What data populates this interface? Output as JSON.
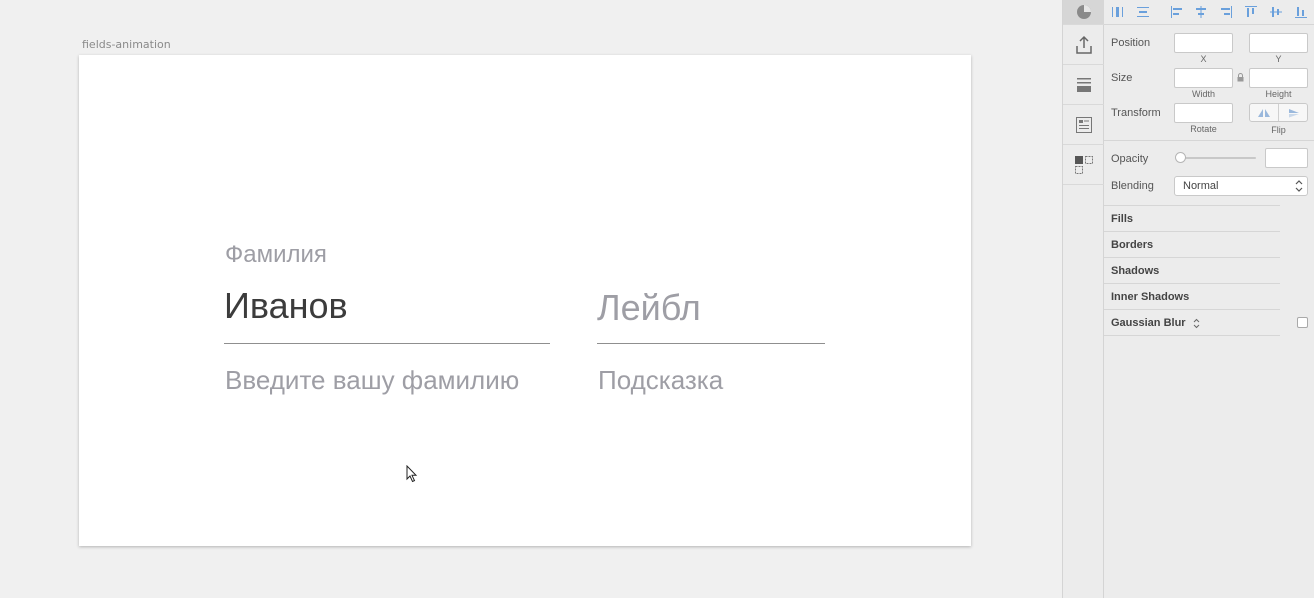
{
  "canvas": {
    "artboard_name": "fields-animation",
    "fields": {
      "lastname": {
        "label": "Фамилия",
        "value": "Иванов",
        "hint": "Введите вашу фамилию"
      },
      "generic": {
        "placeholder": "Лейбл",
        "hint": "Подсказка"
      }
    }
  },
  "toolstrip": {
    "icons": [
      "style-icon",
      "export-icon",
      "layers-icon",
      "list-icon",
      "components-icon"
    ]
  },
  "inspector": {
    "position": {
      "label": "Position",
      "x_label": "X",
      "y_label": "Y",
      "x_value": "",
      "y_value": ""
    },
    "size": {
      "label": "Size",
      "width_label": "Width",
      "height_label": "Height",
      "width_value": "",
      "height_value": ""
    },
    "transform": {
      "label": "Transform",
      "rotate_label": "Rotate",
      "flip_label": "Flip",
      "rotate_value": ""
    },
    "opacity": {
      "label": "Opacity",
      "value": ""
    },
    "blending": {
      "label": "Blending",
      "value": "Normal"
    },
    "sections": [
      "Fills",
      "Borders",
      "Shadows",
      "Inner Shadows",
      "Gaussian Blur"
    ]
  },
  "colors": {
    "canvas_bg": "#f0f0f0",
    "artboard_bg": "#ffffff",
    "text_dark": "#3c3c3c",
    "text_muted": "#9e9ea5",
    "accent_blue": "#6aa0dc"
  }
}
